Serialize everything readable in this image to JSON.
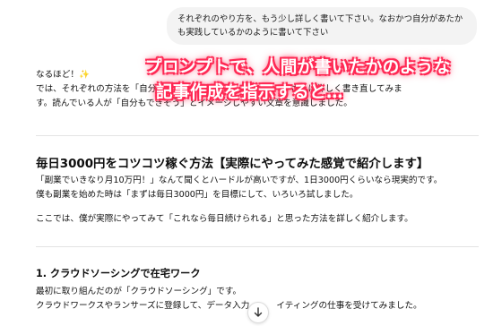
{
  "user_message": {
    "line1": "それぞれのやり方を、もう少し詳しく書いて下さい。なおかつ自分があたか",
    "line2": "も実践しているかのように書いて下さい"
  },
  "assistant": {
    "intro1": "なるほど！",
    "sparkle": "✨",
    "intro2a": "では、それぞれの方法を「自分",
    "intro2b": "さらに詳しく書き直してみま",
    "intro3": "す。読んでいる人が「自分もできそう」とイメージしやすい文章を意識しました。",
    "heading": "毎日3000円をコツコツ稼ぐ方法【実際にやってみた感覚で紹介します】",
    "para1_line1": "「副業でいきなり月10万円！」なんて聞くとハードルが高いですが、1日3000円くらいなら現実的です。",
    "para1_line2": "僕も副業を始めた時は「まずは毎日3000円」を目標にして、いろいろ試しました。",
    "para2": "ここでは、僕が実際にやってみて「これなら毎日続けられる」と思った方法を詳しく紹介します。",
    "section1_heading": "1. クラウドソーシングで在宅ワーク",
    "section1_line1": "最初に取り組んだのが「クラウドソーシング」です。",
    "section1_line2a": "クラウドワークスやランサーズに登録して、データ入力",
    "section1_line2b": "イティングの仕事を受けてみました。"
  },
  "overlay_caption": {
    "line1": "プロンプトで、人間が書いたかのような",
    "line2": "記事作成を指示すると…"
  },
  "icons": {
    "scroll_down": "arrow-down-icon"
  },
  "colors": {
    "overlay_outline": "#ff2a55",
    "bubble_bg": "#f3f3f3"
  }
}
